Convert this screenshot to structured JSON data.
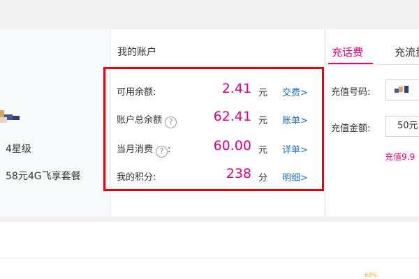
{
  "profile": {
    "level": "4星级",
    "plan": "58元4G飞享套餐"
  },
  "account": {
    "title": "我的账户",
    "rows": [
      {
        "label": "可用余额:",
        "help": false,
        "value": "2.41",
        "unit": "元",
        "link": "交费>"
      },
      {
        "label": "账户总余额",
        "help": true,
        "help_symbol": "?",
        "value": "62.41",
        "unit": "元",
        "link": "账单>"
      },
      {
        "label": "当月消费",
        "help": true,
        "help_symbol": "?",
        "value": "60.00",
        "unit": "元",
        "link": "详单>"
      },
      {
        "label": "我的积分:",
        "help": false,
        "value": "238",
        "unit": "分",
        "link": "明细>"
      }
    ]
  },
  "recharge": {
    "tab_active": "充话费",
    "tab_other": "充流量",
    "phone_label": "充值号码:",
    "amount_label": "充值金额:",
    "amount_value": "50元",
    "promo": "充值9.9"
  },
  "bottom": {
    "tag": "60%"
  },
  "colors": {
    "accent": "#e4007f",
    "highlight_box": "#e60012",
    "link": "#1a6fc4"
  }
}
